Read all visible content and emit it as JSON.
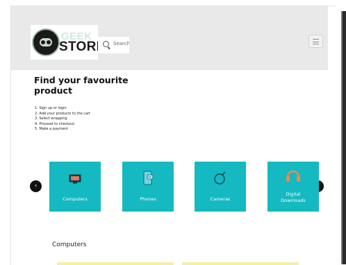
{
  "header": {
    "logo_top": "GEEK",
    "logo_bottom": "STORE",
    "search_placeholder": "Search",
    "menu_icon": "hamburger-icon"
  },
  "hero": {
    "title": "Find your favourite product",
    "steps": [
      "1. Sign up or login",
      "2. Add your products to the cart",
      "3. Select wrapping",
      "4. Proceed to checkout",
      "5. Make a payment"
    ]
  },
  "carousel": {
    "prev_icon": "chevron-left-icon",
    "next_icon": "chevron-right-icon",
    "categories": [
      {
        "label": "Computers",
        "icon": "monitor-icon"
      },
      {
        "label": "Phones",
        "icon": "phone-icon"
      },
      {
        "label": "Cameras",
        "icon": "camera-icon"
      },
      {
        "label": "Digital Downloads",
        "icon": "headphones-icon"
      }
    ]
  },
  "section": {
    "title": "Computers"
  },
  "colors": {
    "accent": "#14b9c1",
    "header_bg": "#e9e9e9",
    "card_strip": "#f3f0a6"
  }
}
